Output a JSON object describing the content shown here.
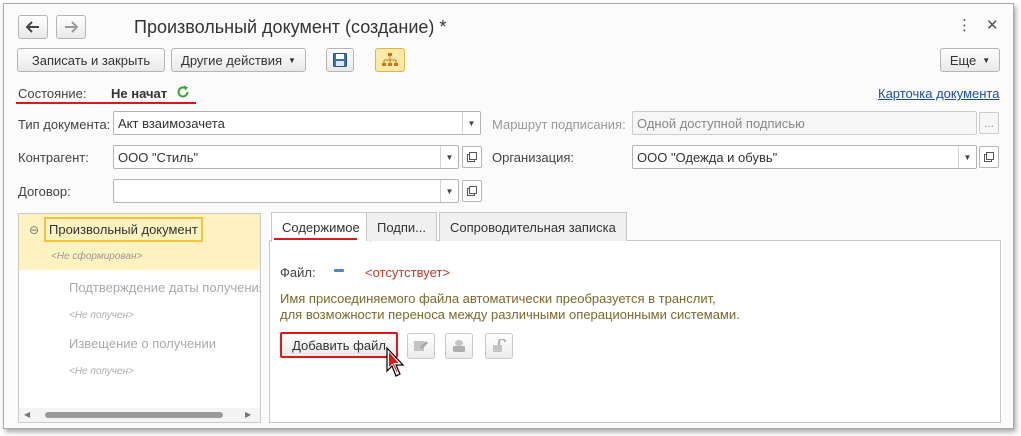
{
  "window": {
    "title": "Произвольный документ (создание) *",
    "more_icon": "more-vertical-icon",
    "close_icon": "close-icon"
  },
  "toolbar": {
    "save_close": "Записать и закрыть",
    "other_actions": "Другие действия",
    "more": "Еще"
  },
  "status": {
    "label": "Состояние:",
    "value": "Не начат",
    "card_link": "Карточка документа"
  },
  "fields": {
    "doc_type_label": "Тип документа:",
    "doc_type_value": "Акт взаимозачета",
    "route_label": "Маршрут подписания:",
    "route_value": "Одной доступной подписью",
    "route_more": "...",
    "counterparty_label": "Контрагент:",
    "counterparty_value": "ООО \"Стиль\"",
    "org_label": "Организация:",
    "org_value": "ООО \"Одежда и обувь\"",
    "contract_label": "Договор:",
    "contract_value": ""
  },
  "tree": {
    "items": [
      {
        "label": "Произвольный документ",
        "collapse_glyph": "⊖"
      },
      {
        "label": "<Не сформирован>"
      },
      {
        "label": "Подтверждение даты получения"
      },
      {
        "label": "<Не получен>"
      },
      {
        "label": "Извещение о получении"
      },
      {
        "label": "<Не получен>"
      }
    ]
  },
  "tabs": [
    "Содержимое",
    "Подпи...",
    "Сопроводительная записка"
  ],
  "content": {
    "file_label": "Файл:",
    "file_value": "<отсутствует>",
    "hint_line1": "Имя присоединяемого файла автоматически преобразуется в транслит,",
    "hint_line2": "для возможности переноса между различными операционными системами.",
    "add_file": "Добавить файл"
  },
  "colors": {
    "accent_red": "#e0161b",
    "link_blue": "#1a4fa8",
    "tree_highlight": "#fdf2c0",
    "file_missing": "#c0392b",
    "hint": "#7a6a2a"
  }
}
